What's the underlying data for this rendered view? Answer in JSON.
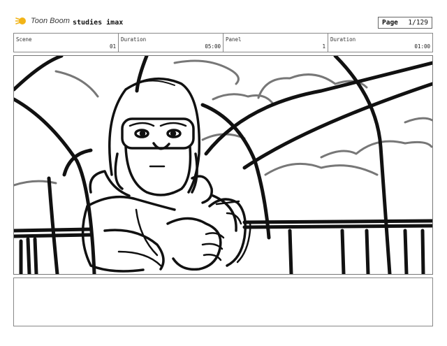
{
  "header": {
    "logo_text": "Toon Boom",
    "project_title": "studies imax",
    "page_label": "Page",
    "page_value": "1/129"
  },
  "info": [
    {
      "label": "Scene",
      "value": "01"
    },
    {
      "label": "Duration",
      "value": "05:00"
    },
    {
      "label": "Panel",
      "value": "1"
    },
    {
      "label": "Duration",
      "value": "01:00"
    }
  ],
  "panel": {
    "drawing": "pilot-in-cockpit-sketch"
  },
  "notes": {
    "text": ""
  }
}
